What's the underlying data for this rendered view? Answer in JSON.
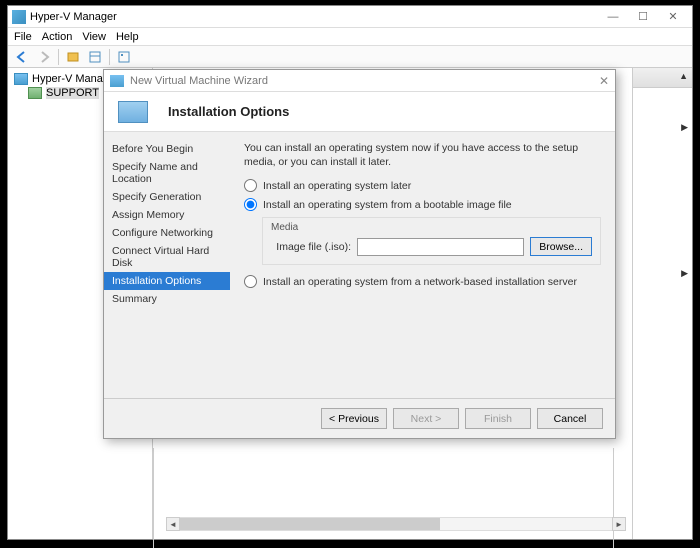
{
  "app": {
    "title": "Hyper-V Manager",
    "menus": [
      "File",
      "Action",
      "View",
      "Help"
    ]
  },
  "tree": {
    "root": "Hyper-V Manager",
    "server": "SUPPORT"
  },
  "dialog": {
    "title": "New Virtual Machine Wizard",
    "heading": "Installation Options",
    "steps": [
      "Before You Begin",
      "Specify Name and Location",
      "Specify Generation",
      "Assign Memory",
      "Configure Networking",
      "Connect Virtual Hard Disk",
      "Installation Options",
      "Summary"
    ],
    "active_step": 6,
    "intro": "You can install an operating system now if you have access to the setup media, or you can install it later.",
    "options": {
      "later": "Install an operating system later",
      "from_image": "Install an operating system from a bootable image file",
      "from_network": "Install an operating system from a network-based installation server",
      "selected": "from_image"
    },
    "media": {
      "group_label": "Media",
      "image_label": "Image file (.iso):",
      "image_value": "",
      "browse": "Browse..."
    },
    "buttons": {
      "previous": "< Previous",
      "next": "Next >",
      "finish": "Finish",
      "cancel": "Cancel"
    }
  }
}
